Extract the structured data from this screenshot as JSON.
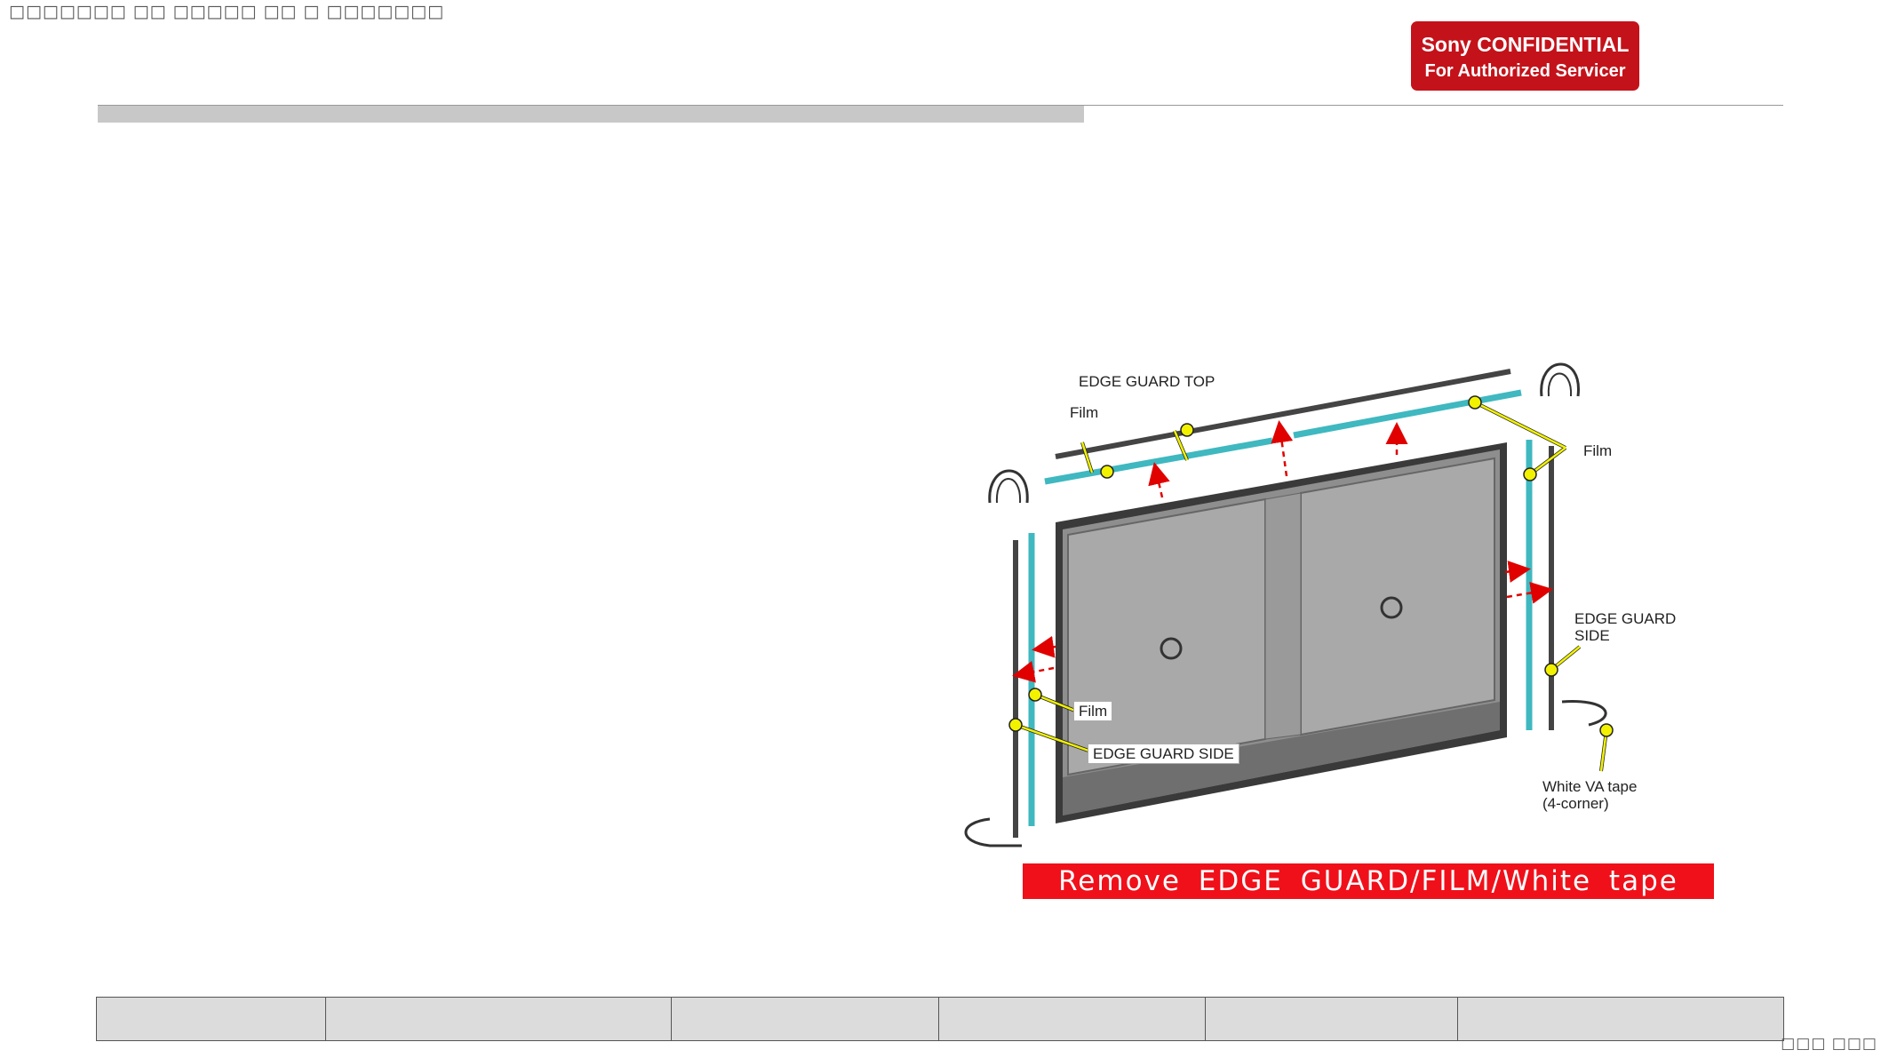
{
  "header": {
    "garbled_text": "□□□□□□□ □□ □□□□□ □□ □ □□□□□□□",
    "confidential_line1": "Sony CONFIDENTIAL",
    "confidential_line2": "For Authorized Servicer"
  },
  "figure": {
    "labels": {
      "edge_guard_top": "EDGE GUARD TOP",
      "film_top_left": "Film",
      "film_top_right": "Film",
      "edge_guard_side_right_1": "EDGE GUARD",
      "edge_guard_side_right_2": "SIDE",
      "film_left": "Film",
      "edge_guard_side_left": "EDGE GUARD SIDE",
      "white_va_tape_1": "White VA tape",
      "white_va_tape_2": "(4-corner)"
    },
    "banner": "Remove  EDGE  GUARD/FILM/White  tape",
    "colors": {
      "banner": "#f0101a",
      "film": "#3fb8c0",
      "callout": "#f2f200",
      "arrow": "#e00000"
    }
  },
  "footer": {
    "cells": [
      "",
      "",
      "",
      "",
      "",
      ""
    ],
    "page_number": "□□□ □□□"
  }
}
